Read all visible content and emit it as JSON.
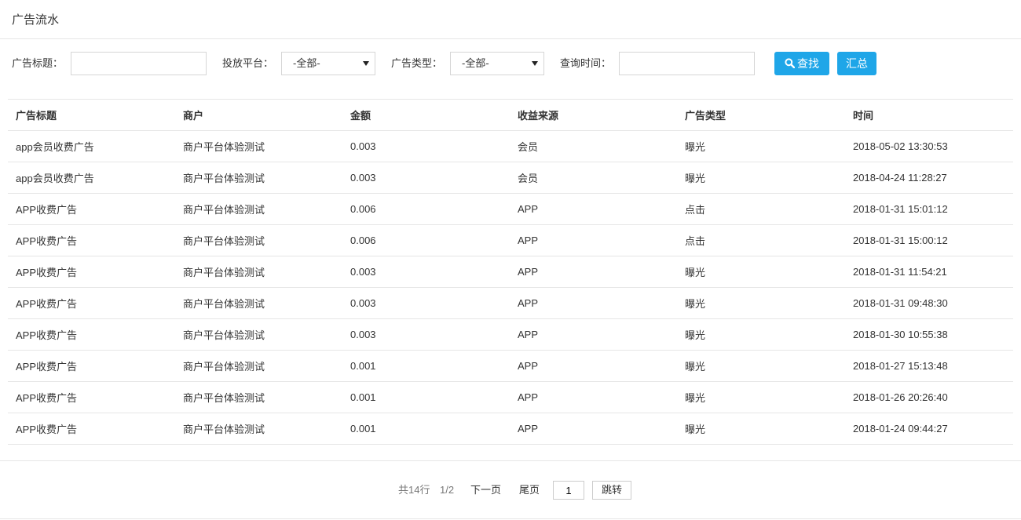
{
  "header": {
    "title": "广告流水"
  },
  "filters": {
    "ad_title_label": "广告标题：",
    "ad_title_value": "",
    "platform_label": "投放平台：",
    "platform_selected": "-全部-",
    "ad_type_label": "广告类型：",
    "ad_type_selected": "-全部-",
    "query_time_label": "查询时间：",
    "query_time_value": "",
    "search_label": "查找",
    "summary_label": "汇总",
    "search_icon": "search-icon"
  },
  "table": {
    "columns": [
      "广告标题",
      "商户",
      "金额",
      "收益来源",
      "广告类型",
      "时间"
    ],
    "rows": [
      [
        "app会员收费广告",
        "商户平台体验测试",
        "0.003",
        "会员",
        "曝光",
        "2018-05-02 13:30:53"
      ],
      [
        "app会员收费广告",
        "商户平台体验测试",
        "0.003",
        "会员",
        "曝光",
        "2018-04-24 11:28:27"
      ],
      [
        "APP收费广告",
        "商户平台体验测试",
        "0.006",
        "APP",
        "点击",
        "2018-01-31 15:01:12"
      ],
      [
        "APP收费广告",
        "商户平台体验测试",
        "0.006",
        "APP",
        "点击",
        "2018-01-31 15:00:12"
      ],
      [
        "APP收费广告",
        "商户平台体验测试",
        "0.003",
        "APP",
        "曝光",
        "2018-01-31 11:54:21"
      ],
      [
        "APP收费广告",
        "商户平台体验测试",
        "0.003",
        "APP",
        "曝光",
        "2018-01-31 09:48:30"
      ],
      [
        "APP收费广告",
        "商户平台体验测试",
        "0.003",
        "APP",
        "曝光",
        "2018-01-30 10:55:38"
      ],
      [
        "APP收费广告",
        "商户平台体验测试",
        "0.001",
        "APP",
        "曝光",
        "2018-01-27 15:13:48"
      ],
      [
        "APP收费广告",
        "商户平台体验测试",
        "0.001",
        "APP",
        "曝光",
        "2018-01-26 20:26:40"
      ],
      [
        "APP收费广告",
        "商户平台体验测试",
        "0.001",
        "APP",
        "曝光",
        "2018-01-24 09:44:27"
      ]
    ]
  },
  "pager": {
    "total_text": "共14行",
    "page_text": "1/2",
    "next_label": "下一页",
    "last_label": "尾页",
    "page_input_value": "1",
    "jump_label": "跳转"
  },
  "colors": {
    "accent": "#1fa6e8",
    "border": "#e6e6e6"
  }
}
